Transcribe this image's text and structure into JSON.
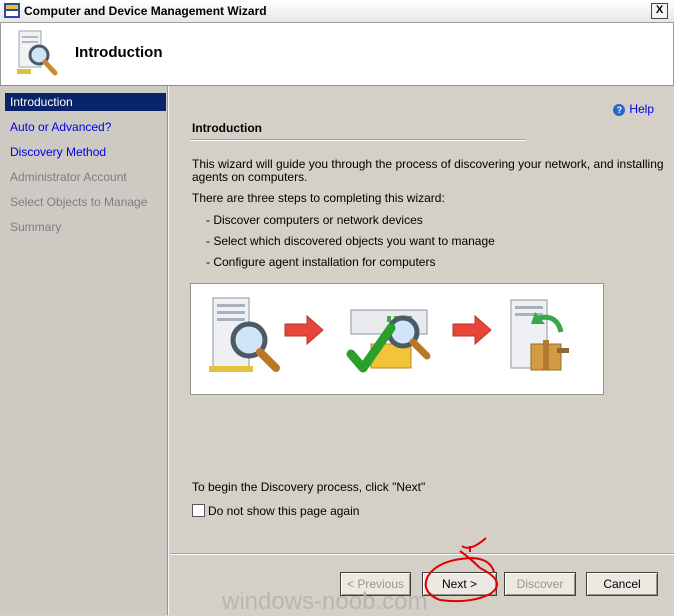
{
  "window": {
    "title": "Computer and Device Management Wizard",
    "close_label": "X"
  },
  "header": {
    "title": "Introduction"
  },
  "nav": {
    "items": [
      {
        "label": "Introduction",
        "state": "active"
      },
      {
        "label": "Auto or Advanced?",
        "state": "link"
      },
      {
        "label": "Discovery Method",
        "state": "link"
      },
      {
        "label": "Administrator Account",
        "state": "disabled"
      },
      {
        "label": "Select Objects to Manage",
        "state": "disabled"
      },
      {
        "label": "Summary",
        "state": "disabled"
      }
    ]
  },
  "content": {
    "help_label": "Help",
    "section_title": "Introduction",
    "intro_line1": "This wizard will guide you through the process of discovering your network, and installing",
    "intro_line2": "agents on computers.",
    "steps_intro": "There are three steps to completing this wizard:",
    "steps": [
      "- Discover computers or network devices",
      "- Select which discovered objects you want to manage",
      "- Configure agent installation for computers"
    ],
    "begin_text": "To begin the Discovery process, click \"Next\"",
    "checkbox_label": "Do not show this page again",
    "checkbox_checked": false
  },
  "buttons": {
    "previous": "< Previous",
    "next": "Next >",
    "discover": "Discover",
    "cancel": "Cancel"
  },
  "watermark": "windows-noob.com",
  "colors": {
    "nav_active": "#0a246a",
    "link": "#0000e0",
    "annotation": "#e00000"
  }
}
